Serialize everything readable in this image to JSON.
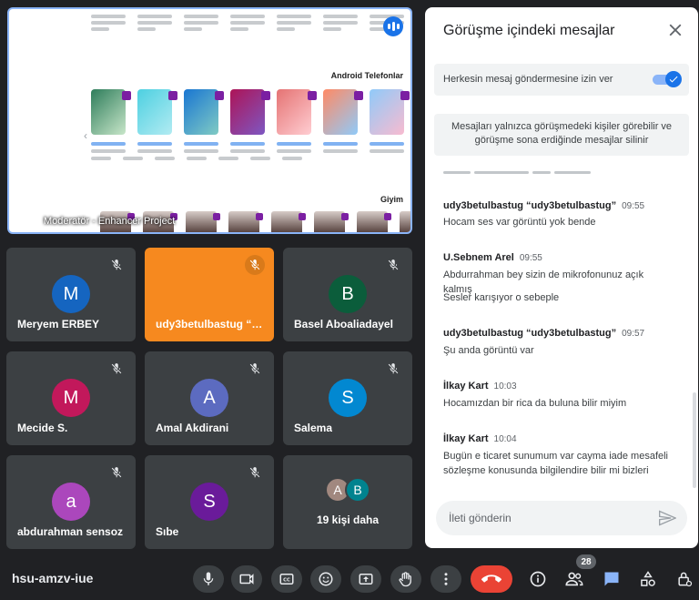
{
  "presentation": {
    "caption": "Moderatör - Enhancer Project",
    "section_headings": [
      "Android Telefonlar",
      "Giyim"
    ]
  },
  "tiles": [
    {
      "name": "Meryem ERBEY",
      "initial": "M",
      "color": "#1565c0",
      "muted": true,
      "speaking": false
    },
    {
      "name": "udy3betulbastug “udy3betulbastug”",
      "initial": "",
      "color": "",
      "muted": true,
      "speaking": true
    },
    {
      "name": "Basel Aboaliadayel",
      "initial": "B",
      "color": "#0b5d3b",
      "muted": true,
      "speaking": false
    },
    {
      "name": "Mecide S.",
      "initial": "M",
      "color": "#c2185b",
      "muted": true,
      "speaking": false
    },
    {
      "name": "Amal Akdirani",
      "initial": "A",
      "color": "#5c6bc0",
      "muted": true,
      "speaking": false
    },
    {
      "name": "Salema",
      "initial": "S",
      "color": "#0288d1",
      "muted": true,
      "speaking": false
    },
    {
      "name": "abdurahman sensoz",
      "initial": "a",
      "color": "#ab47bc",
      "muted": true,
      "speaking": false
    },
    {
      "name": "Sıbe",
      "initial": "S",
      "color": "#6a1b9a",
      "muted": true,
      "speaking": false
    }
  ],
  "more_tile": {
    "label": "19 kişi daha",
    "initials": [
      "A",
      "B"
    ],
    "colors": [
      "#a1887f",
      "#00838f"
    ]
  },
  "chat": {
    "title": "Görüşme içindeki mesajlar",
    "allow_label": "Herkesin mesaj göndermesine izin ver",
    "allow_enabled": true,
    "info": "Mesajları yalnızca görüşmedeki kişiler görebilir ve görüşme sona erdiğinde mesajlar silinir",
    "messages": [
      {
        "sender": "udy3betulbastug “udy3betulbastug”",
        "time": "09:55",
        "lines": [
          "Hocam ses var görüntü yok bende"
        ]
      },
      {
        "sender": "U.Sebnem Arel",
        "time": "09:55",
        "lines": [
          "Abdurrahman bey sizin de mikrofonunuz açık kalmış",
          "Sesler karışıyor o sebeple"
        ]
      },
      {
        "sender": "udy3betulbastug “udy3betulbastug”",
        "time": "09:57",
        "lines": [
          "Şu anda görüntü var"
        ]
      },
      {
        "sender": "İlkay Kart",
        "time": "10:03",
        "lines": [
          "Hocamızdan bir rica da buluna bilir miyim"
        ]
      },
      {
        "sender": "İlkay Kart",
        "time": "10:04",
        "lines": [
          "Bugün e ticaret sunumum var cayma iade mesafeli sözleşme konusunda bilgilendire bilir mi bizleri"
        ]
      }
    ],
    "input_placeholder": "İleti gönderin"
  },
  "bottom_bar": {
    "meeting_code": "hsu-amzv-iue",
    "participant_count": "28",
    "controls": [
      "mic-icon",
      "camera-icon",
      "captions-icon",
      "emoji-icon",
      "present-icon",
      "raise-hand-icon",
      "more-icon",
      "end-call-icon"
    ],
    "right_controls": [
      "info-icon",
      "people-icon",
      "chat-icon",
      "activities-icon",
      "host-controls-icon"
    ]
  }
}
